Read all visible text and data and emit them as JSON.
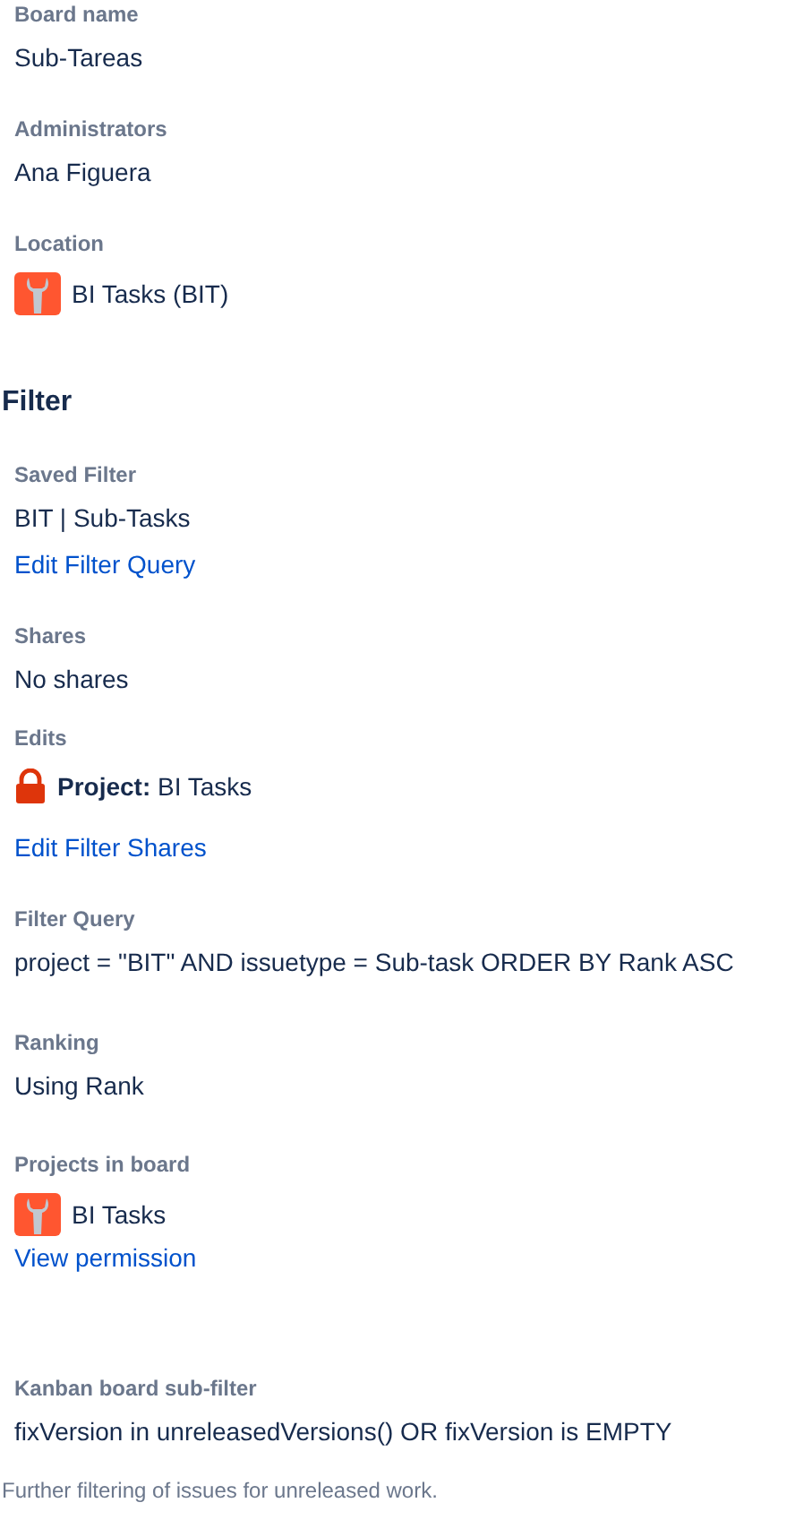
{
  "details": {
    "fields": [
      {
        "label": "Board name",
        "items": [
          {
            "kind": "text",
            "text": "Sub-Tareas"
          }
        ]
      },
      {
        "label": "Administrators",
        "items": [
          {
            "kind": "text",
            "text": "Ana Figuera"
          }
        ]
      },
      {
        "label": "Location",
        "items": [
          {
            "kind": "project",
            "text": "BI Tasks (BIT)"
          }
        ]
      }
    ]
  },
  "filter": {
    "heading": "Filter",
    "fields": [
      {
        "label": "Saved Filter",
        "items": [
          {
            "kind": "text",
            "text": "BIT | Sub-Tasks"
          },
          {
            "kind": "link",
            "text": "Edit Filter Query"
          }
        ]
      },
      {
        "label": "Shares",
        "items": [
          {
            "kind": "text",
            "text": "No shares"
          }
        ]
      },
      {
        "label": "Edits",
        "items": [
          {
            "kind": "permission",
            "text": "**Project:** BI Tasks"
          },
          {
            "kind": "link",
            "text": "Edit Filter Shares"
          }
        ]
      },
      {
        "label": "Filter Query",
        "items": [
          {
            "kind": "text",
            "text": "project = \"BIT\" AND issuetype = Sub-task ORDER BY Rank ASC"
          }
        ]
      },
      {
        "label": "Ranking",
        "items": [
          {
            "kind": "text",
            "text": "Using Rank"
          }
        ]
      },
      {
        "label": "Projects in board",
        "items": [
          {
            "kind": "project",
            "text": "BI Tasks"
          },
          {
            "kind": "link",
            "text": "View permission"
          }
        ]
      },
      {
        "label": "Kanban board sub-filter",
        "items": [
          {
            "kind": "text",
            "text": "fixVersion in unreleasedVersions() OR fixVersion is EMPTY"
          }
        ]
      }
    ],
    "note": "Further filtering of issues for unreleased work."
  }
}
